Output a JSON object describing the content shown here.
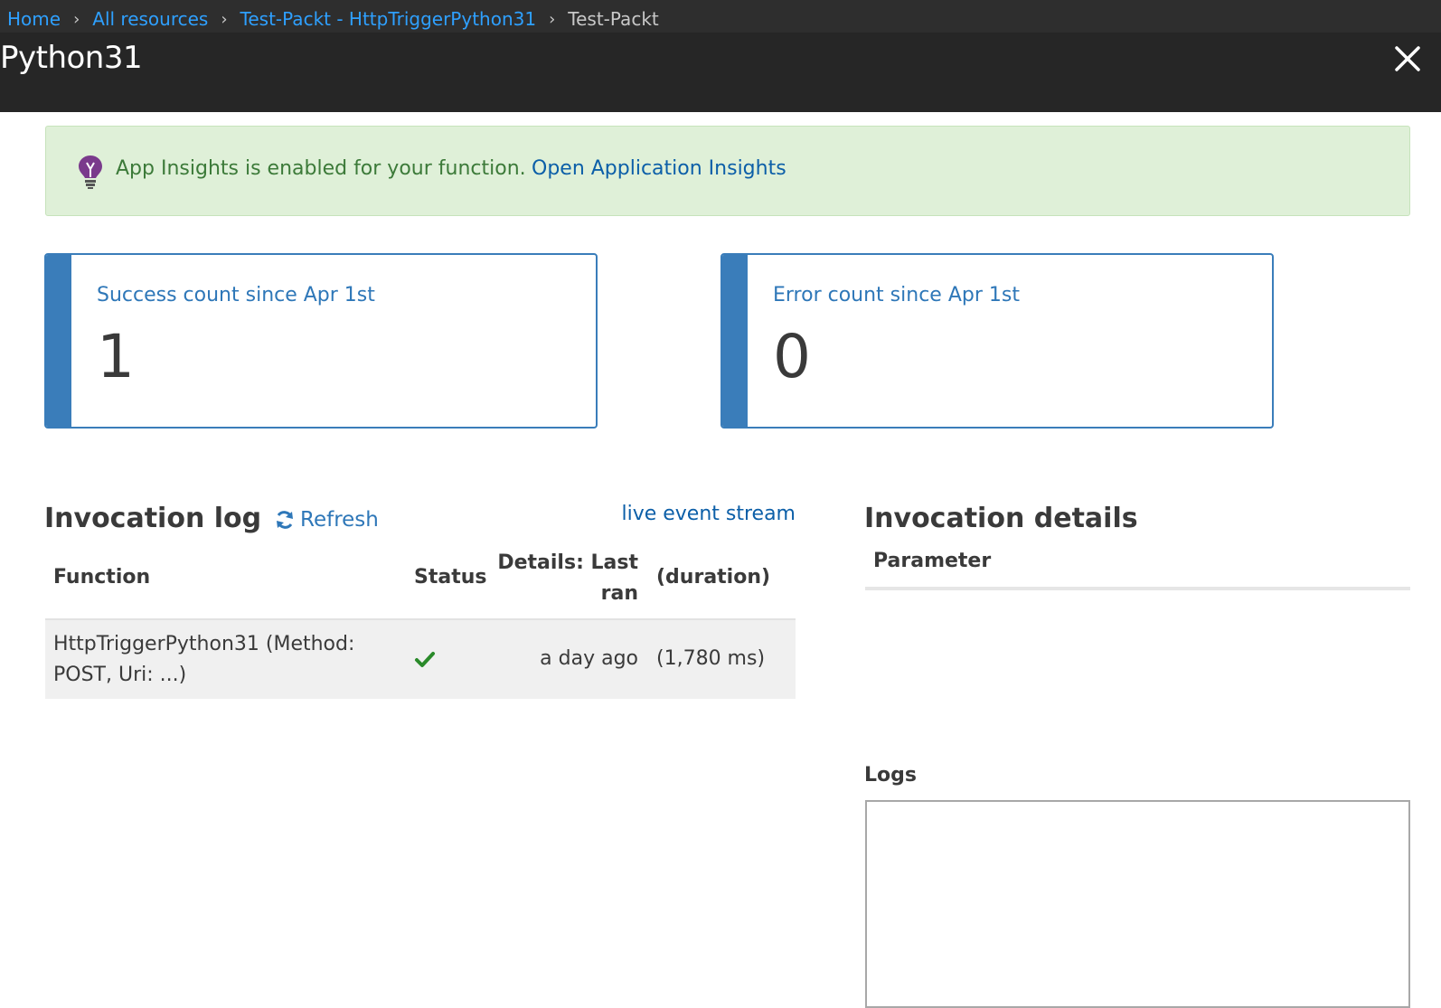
{
  "breadcrumb": {
    "items": [
      "Home",
      "All resources",
      "Test-Packt - HttpTriggerPython31"
    ],
    "current": "Test-Packt"
  },
  "blade": {
    "title": "Python31",
    "close_icon": "close-icon"
  },
  "banner": {
    "icon": "lightbulb-icon",
    "message": "App Insights is enabled for your function.",
    "link": "Open Application Insights",
    "colors": {
      "background": "#dff0d8",
      "text": "#3c7a39",
      "link": "#0c5fa8"
    }
  },
  "stats": {
    "success": {
      "label": "Success count since Apr 1st",
      "value": "1"
    },
    "error": {
      "label": "Error count since Apr 1st",
      "value": "0"
    },
    "accent_color": "#3a7dba"
  },
  "invocation_log": {
    "heading": "Invocation log",
    "refresh_label": "Refresh",
    "refresh_icon": "refresh-icon",
    "live_stream_link": "live event stream",
    "columns": {
      "function": "Function",
      "status": "Status",
      "details_line1": "Details: Last",
      "details_line2": "ran",
      "duration": "(duration)"
    },
    "rows": [
      {
        "function_line1": "HttpTriggerPython31 (Method:",
        "function_line2": "POST, Uri: ...)",
        "status_icon": "checkmark-icon",
        "last_ran": "a day ago",
        "duration": "(1,780 ms)"
      }
    ]
  },
  "invocation_details": {
    "heading": "Invocation details",
    "parameter_label": "Parameter",
    "logs_label": "Logs"
  }
}
